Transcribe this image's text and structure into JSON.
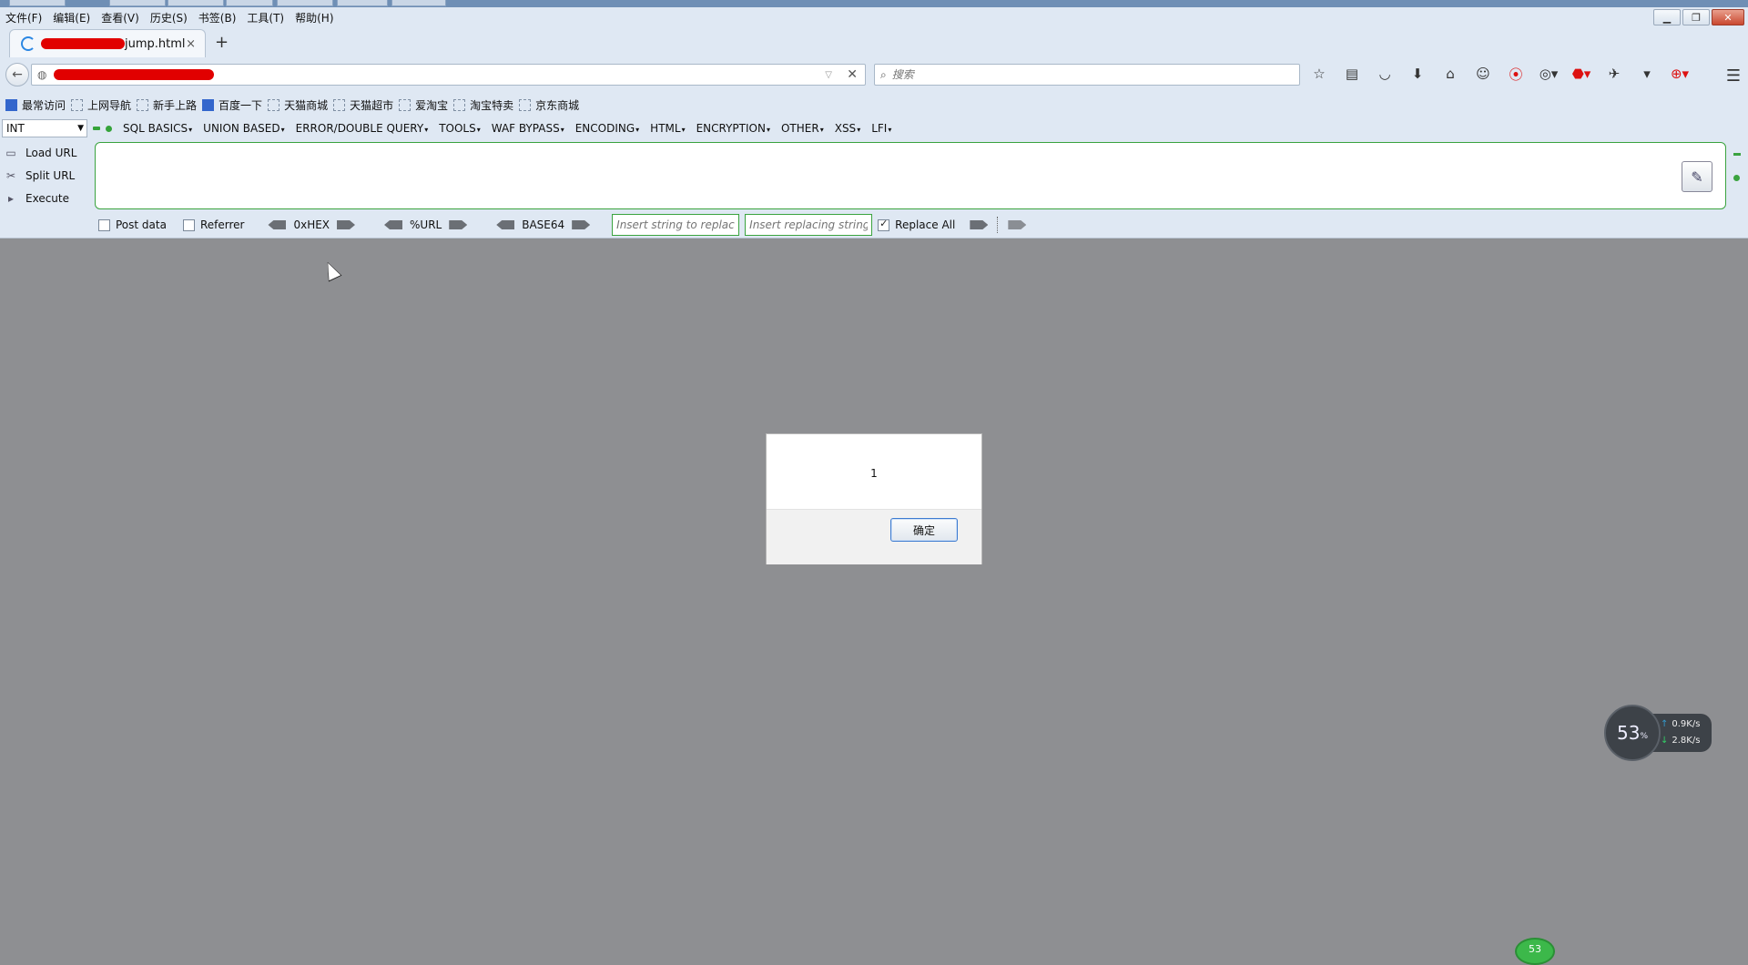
{
  "menu": [
    "文件(F)",
    "编辑(E)",
    "查看(V)",
    "历史(S)",
    "书签(B)",
    "工具(T)",
    "帮助(H)"
  ],
  "tab": {
    "title": "jump.html",
    "close": "×",
    "new_tab": "+"
  },
  "search": {
    "placeholder": "搜索"
  },
  "bookmarks": [
    "最常访问",
    "上网导航",
    "新手上路",
    "百度一下",
    "天猫商城",
    "天猫超市",
    "爱淘宝",
    "淘宝特卖",
    "京东商城"
  ],
  "hackbar": {
    "select_value": "INT",
    "menus": [
      "SQL BASICS",
      "UNION BASED",
      "ERROR/DOUBLE QUERY",
      "TOOLS",
      "WAF BYPASS",
      "ENCODING",
      "HTML",
      "ENCRYPTION",
      "OTHER",
      "XSS",
      "LFI"
    ],
    "actions": [
      "Load URL",
      "Split URL",
      "Execute"
    ],
    "post_data": "Post data",
    "referrer": "Referrer",
    "enc": [
      "0xHEX",
      "%URL",
      "BASE64"
    ],
    "insert_placeholder": "Insert string to replace",
    "replacing_placeholder": "Insert replacing string",
    "replace_all": "Replace All"
  },
  "dialog": {
    "message": "1",
    "ok_label": "确定"
  },
  "network": {
    "percent": "53",
    "percent_unit": "%",
    "up": "0.9K/s",
    "down": "2.8K/s"
  },
  "tray_badge": "53"
}
